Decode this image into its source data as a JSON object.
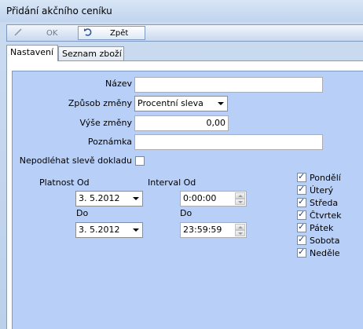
{
  "window": {
    "title": "Přidání akčního ceníku"
  },
  "toolbar": {
    "ok_label": "OK",
    "back_label": "Zpět"
  },
  "tabs": [
    {
      "label": "Nastavení"
    },
    {
      "label": "Seznam zboží"
    }
  ],
  "form": {
    "name_label": "Název",
    "name_value": "",
    "change_mode_label": "Způsob změny",
    "change_mode_value": "Procentní sleva",
    "change_amount_label": "Výše změny",
    "change_amount_value": "0,00",
    "note_label": "Poznámka",
    "note_value": "",
    "no_receipt_discount_label": "Nepodléhat slevě dokladu",
    "validity_from_label": "Platnost Od",
    "validity_from_value": "3.  5.2012",
    "validity_to_label": "Do",
    "validity_to_value": "3.  5.2012",
    "interval_from_label": "Interval Od",
    "interval_from_value": "0:00:00",
    "interval_to_label": "Do",
    "interval_to_value": "23:59:59"
  },
  "days": [
    {
      "label": "Pondělí",
      "checked": true
    },
    {
      "label": "Úterý",
      "checked": true
    },
    {
      "label": "Středa",
      "checked": true
    },
    {
      "label": "Čtvrtek",
      "checked": true
    },
    {
      "label": "Pátek",
      "checked": true
    },
    {
      "label": "Sobota",
      "checked": true
    },
    {
      "label": "Neděle",
      "checked": true
    }
  ]
}
